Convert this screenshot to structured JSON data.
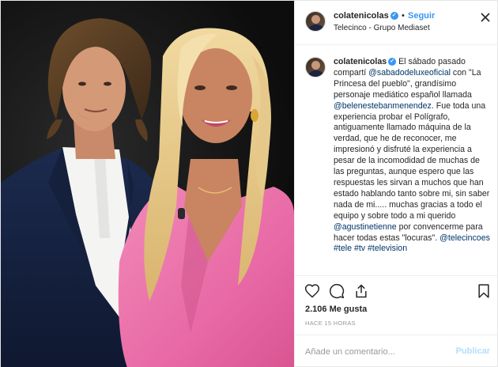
{
  "post": {
    "username": "colatenicolas",
    "follow_label": "Seguir",
    "location": "Telecinco - Grupo Mediaset",
    "separator": "•",
    "verified_glyph": "✓",
    "more_glyph": "✕",
    "caption": {
      "t1": "El sábado pasado compartí ",
      "m1": "@sabadodeluxeoficial",
      "t2": " con \"La Princesa del pueblo\", grandísimo personaje mediático español llamada ",
      "m2": "@belenestebanmenendez",
      "t3": ". Fue toda una experiencia probar el Polígrafo, antiguamente llamado máquina de la verdad, que he de reconocer, me impresionó y disfruté la experiencia a pesar de la incomodidad de muchas de las preguntas, aunque espero que las respuestas les sirvan a muchos que han estado hablando tanto sobre mi, sin saber nada de mi..... muchas gracias a todo el equipo y sobre todo a mi querido ",
      "m3": "@agustinetienne",
      "t4": " por convencerme para hacer todas estas \"locuras\". ",
      "m4": "@telecincoes",
      "h1": "#tele",
      "h2": "#tv",
      "h3": "#television"
    },
    "likes": "2.106 Me gusta",
    "time": "HACE 15 HORAS",
    "comment_placeholder": "Añade un comentario...",
    "publish_label": "Publicar",
    "icons": [
      "heart-icon",
      "comment-icon",
      "share-icon",
      "bookmark-icon",
      "verified-icon",
      "more-icon"
    ],
    "colors": {
      "accent": "#3897f0",
      "link": "#003569",
      "muted": "#999999",
      "publish_disabled": "#b2dffc"
    }
  }
}
